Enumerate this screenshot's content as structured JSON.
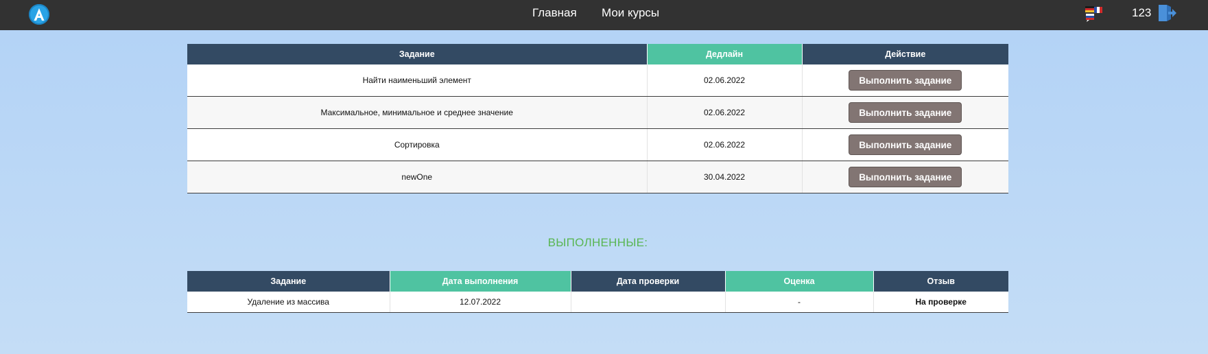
{
  "header": {
    "logo_letter": "A",
    "nav": {
      "home": "Главная",
      "courses": "Мои курсы"
    },
    "user_number": "123",
    "icons": {
      "logo": "app-logo-icon",
      "language": "flags-language-icon",
      "logout": "logout-door-icon"
    }
  },
  "tasks_table": {
    "headers": {
      "task": "Задание",
      "deadline": "Дедлайн",
      "action": "Действие"
    },
    "rows": [
      {
        "task": "Найти наименьший элемент",
        "deadline": "02.06.2022",
        "action": "Выполнить задание"
      },
      {
        "task": "Максимальное, минимальное и среднее значение",
        "deadline": "02.06.2022",
        "action": "Выполнить задание"
      },
      {
        "task": "Сортировка",
        "deadline": "02.06.2022",
        "action": "Выполнить задание"
      },
      {
        "task": "newOne",
        "deadline": "30.04.2022",
        "action": "Выполнить задание"
      }
    ]
  },
  "completed": {
    "title": "ВЫПОЛНЕННЫЕ:",
    "headers": {
      "task": "Задание",
      "done_date": "Дата выполнения",
      "check_date": "Дата проверки",
      "grade": "Оценка",
      "review": "Отзыв"
    },
    "rows": [
      {
        "task": "Удаление из массива",
        "done_date": "12.07.2022",
        "check_date": "",
        "grade": "-",
        "review": "На проверке"
      }
    ]
  },
  "colors": {
    "topbar": "#323232",
    "header_dark": "#334a63",
    "header_accent": "#4fc3a1",
    "button": "#827573",
    "section_title": "#59b653",
    "background_top": "#b2d2f6",
    "background_bottom": "#c4ddf6"
  }
}
